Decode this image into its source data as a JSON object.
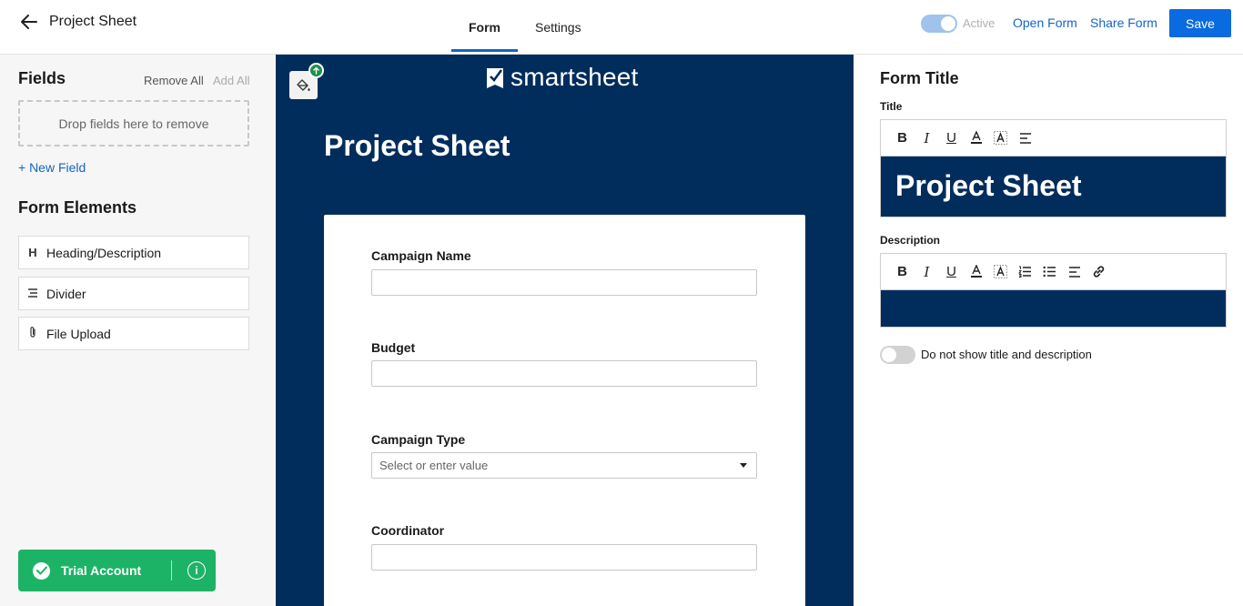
{
  "header": {
    "app_title": "Project Sheet",
    "tabs": [
      {
        "label": "Form",
        "active": true
      },
      {
        "label": "Settings",
        "active": false
      }
    ],
    "active_toggle_label": "Active",
    "open_form": "Open Form",
    "share_form": "Share Form",
    "save": "Save",
    "accent_color": "#0a6be0"
  },
  "left_panel": {
    "fields_title": "Fields",
    "remove_all": "Remove All",
    "add_all": "Add All",
    "dropzone_text": "Drop fields here to remove",
    "new_field": "+ New Field",
    "elements_title": "Form Elements",
    "elements": [
      {
        "icon": "H",
        "label": "Heading/Description"
      },
      {
        "icon": "divider-icon",
        "label": "Divider"
      },
      {
        "icon": "paperclip-icon",
        "label": "File Upload"
      }
    ],
    "trial": {
      "label": "Trial Account",
      "color": "#1db366"
    }
  },
  "preview": {
    "background": "#002d5c",
    "logo_text": "smartsheet",
    "title": "Project Sheet",
    "questions": [
      {
        "label": "Campaign Name",
        "type": "text"
      },
      {
        "label": "Budget",
        "type": "text"
      },
      {
        "label": "Campaign Type",
        "type": "select",
        "placeholder": "Select or enter value"
      },
      {
        "label": "Coordinator",
        "type": "text"
      }
    ]
  },
  "right_panel": {
    "section_title": "Form Title",
    "title_label": "Title",
    "title_value": "Project Sheet",
    "description_label": "Description",
    "hide_toggle_label": "Do not show title and description",
    "hide_toggle_on": false
  }
}
